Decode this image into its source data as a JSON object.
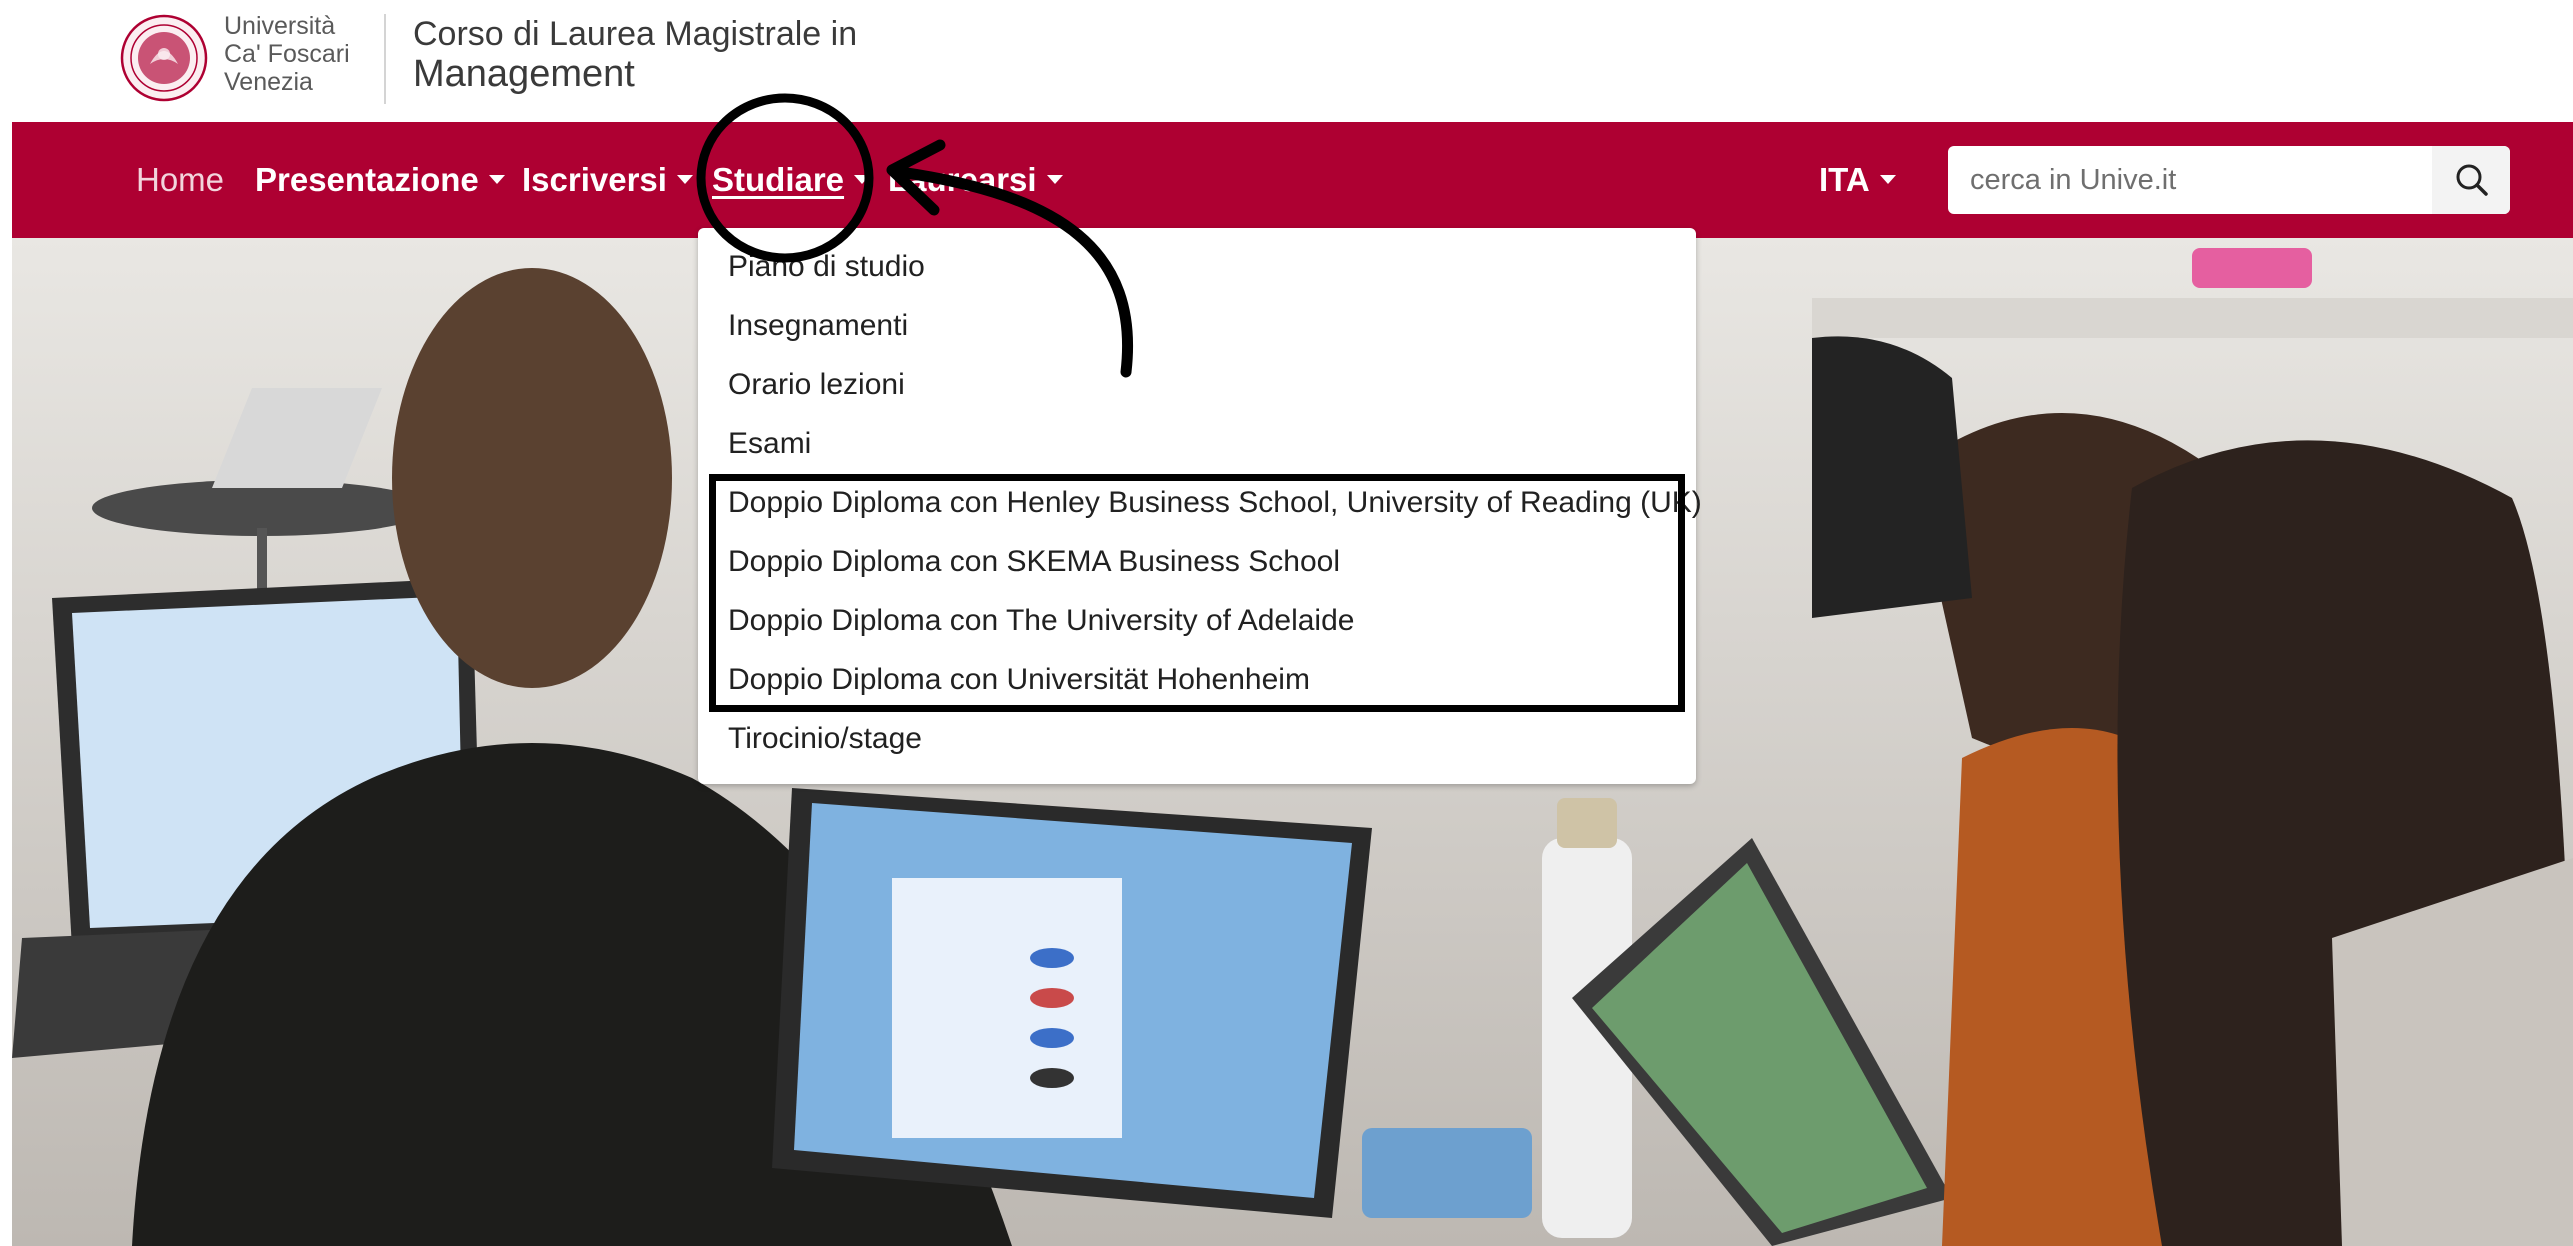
{
  "university": {
    "line1": "Università",
    "line2": "Ca' Foscari",
    "line3": "Venezia"
  },
  "course": {
    "line1": "Corso di Laurea Magistrale in",
    "line2": "Management"
  },
  "nav": {
    "home": "Home",
    "presentazione": "Presentazione",
    "iscriversi": "Iscriversi",
    "studiare": "Studiare",
    "laurearsi": "Laurearsi",
    "language": "ITA"
  },
  "search": {
    "placeholder": "cerca in Unive.it",
    "value": ""
  },
  "dropdown": {
    "items": [
      "Piano di studio",
      "Insegnamenti",
      "Orario lezioni",
      "Esami",
      "Doppio Diploma con Henley Business School, University of Reading (UK)",
      "Doppio Diploma con SKEMA Business School",
      "Doppio Diploma con The University of Adelaide",
      "Doppio Diploma con Universität Hohenheim",
      "Tirocinio/stage"
    ]
  },
  "colors": {
    "brand": "#ae0032",
    "white": "#ffffff",
    "annotation": "#000000"
  },
  "icons": {
    "search": "search-icon",
    "logo": "university-seal-logo"
  }
}
